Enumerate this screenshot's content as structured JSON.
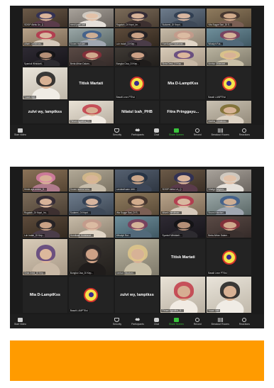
{
  "top": {
    "tiles": [
      {
        "kind": "cam",
        "name": "SDSIP Aleks Un_Q",
        "c": [
          "#6b5a48",
          "#3b2f26",
          "#d9b39a",
          "#2b2e58",
          "#5a3b4a"
        ]
      },
      {
        "kind": "cam",
        "name": "mesti jalan Arif",
        "c": [
          "#a9a39b",
          "#6b6560",
          "#e2c1a8",
          "#d9d2c9",
          "#e5e0da"
        ]
      },
      {
        "kind": "cam",
        "name": "Rugaiah_DI Kepri_Im...",
        "c": [
          "#7b6b59",
          "#4b3f33",
          "#d6b298",
          "#2c2433",
          "#3d3030"
        ]
      },
      {
        "kind": "cam",
        "name": "Sudarmi_DI Kepri...",
        "c": [
          "#6e7c8c",
          "#3c4653",
          "#d7b59f",
          "#2c3a4d",
          "#3e4958"
        ]
      },
      {
        "kind": "cam",
        "name": "Vita Sugye Sari_DI S...",
        "c": [
          "#8f7b5e",
          "#5a4b38",
          "#d1ab8c",
          "#3d2f2a",
          "#7b5f54"
        ]
      },
      {
        "kind": "cam",
        "name": "Alfarti Christinaw...",
        "c": [
          "#b8a38a",
          "#7d6a56",
          "#d8b8a0",
          "#b5314a",
          "#d6c9bb"
        ]
      },
      {
        "kind": "cam",
        "name": "Srunni Handari...",
        "c": [
          "#9aa7a7",
          "#5b6867",
          "#cdae95",
          "#3a5b8a",
          "#a0a7b1"
        ]
      },
      {
        "kind": "cam",
        "name": "Luh Indah_DI Kep...",
        "c": [
          "#5d4b3b",
          "#33291f",
          "#caa286",
          "#1e1d22",
          "#4a3c48"
        ]
      },
      {
        "kind": "cam",
        "name": "Hornikaeli Hutabarat...",
        "c": [
          "#c7bba8",
          "#8e8271",
          "#dbbba2",
          "#c59a8b",
          "#e1d5c6"
        ]
      },
      {
        "kind": "cam",
        "name": "Winaiyh Rut...",
        "c": [
          "#6f8f9b",
          "#405863",
          "#d5b399",
          "#7b3a59",
          "#52697a"
        ]
      },
      {
        "kind": "cam",
        "name": "Syaniuli Winidarti...",
        "c": [
          "#2e2a33",
          "#17151a",
          "#b48f77",
          "#121214",
          "#2d2b30"
        ]
      },
      {
        "kind": "cam",
        "name": "Berta Afrian Dalam...",
        "c": [
          "#5a4a45",
          "#352b29",
          "#d1a98d",
          "#8b2e3a",
          "#3a302e"
        ]
      },
      {
        "kind": "cam",
        "name": "Bungka Cisa_DI Kep...",
        "c": [
          "#3f3a35",
          "#221f1c",
          "#cda186",
          "#2a2626",
          "#1f1c1b"
        ]
      },
      {
        "kind": "cam",
        "name": "Sinta Dewi_DI Kep...",
        "c": [
          "#d8cbb8",
          "#a89987",
          "#dcb79c",
          "#5a3e7a",
          "#c9b9a6"
        ]
      },
      {
        "kind": "cam",
        "name": "Annisa Oktaviani...",
        "c": [
          "#b9b39f",
          "#7f7a6b",
          "#d7b296",
          "#e0c78a",
          "#c9c0a8"
        ]
      },
      {
        "kind": "cam",
        "name": "Yusari Aish",
        "c": [
          "#e9e4da",
          "#c0b8aa",
          "#d8b194",
          "#1c1c1c",
          "#f0ece5"
        ]
      },
      {
        "kind": "blank",
        "name": "Titisk Martati"
      },
      {
        "kind": "logo",
        "name": "Basalt Leon PTKsi"
      },
      {
        "kind": "blank",
        "name": "Mia D-LamptKss"
      },
      {
        "kind": "logo",
        "name": "Basalt LAMPTKsi"
      },
      {
        "kind": "blank",
        "name": "zulvi wy, lamptkss"
      },
      {
        "kind": "cam",
        "name": "Fitriani Agustina_D...",
        "c": [
          "#e9e2d6",
          "#b9b0a2",
          "#d6ae92",
          "#c23a46",
          "#f1ebe3"
        ]
      },
      {
        "kind": "blank",
        "name": "Nilatul Izah_PHB"
      },
      {
        "kind": "blank",
        "name": "Fitra Pringgayu..."
      },
      {
        "kind": "cam",
        "name": "Martha_Citrakusu...",
        "c": [
          "#c9c1b2",
          "#958c7c",
          "#d7b395",
          "#7a6a2a",
          "#ddd3c4"
        ]
      }
    ],
    "toolbar": [
      "Start Video",
      "Security",
      "Participants",
      "Chat",
      "Share Screen",
      "Record",
      "Breakout Rooms",
      "Reactions"
    ]
  },
  "bottom": {
    "tiles": [
      {
        "kind": "cam",
        "name": "Hesfa aya ambrs_D...",
        "c": [
          "#8a7258",
          "#564533",
          "#d7b097",
          "#d97fa7",
          "#b07b8c"
        ]
      },
      {
        "kind": "cam",
        "name": "Srunni Isetrhe tuba...",
        "c": [
          "#b2a997",
          "#7b7363",
          "#d8b598",
          "#d6ba8a",
          "#c6bcaa"
        ]
      },
      {
        "kind": "cam",
        "name": "Landasthuam Jefri...",
        "c": [
          "#556070",
          "#2f3742",
          "#caa589",
          "#233042",
          "#3c4657"
        ]
      },
      {
        "kind": "cam",
        "name": "SDSIP Aleks Un_Q",
        "c": [
          "#6b5a48",
          "#3b2f26",
          "#d9b39a",
          "#2b2e58",
          "#5a3b4a"
        ]
      },
      {
        "kind": "cam",
        "name": "Vitaligt Fatiyurs...",
        "c": [
          "#a9a39b",
          "#6b6560",
          "#e2c1a8",
          "#d9d2c9",
          "#e5e0da"
        ]
      },
      {
        "kind": "cam",
        "name": "Rugaiah_DI Kepri_Im...",
        "c": [
          "#7b6b59",
          "#4b3f33",
          "#d6b298",
          "#2c2433",
          "#3d3030"
        ]
      },
      {
        "kind": "cam",
        "name": "Sudarmi_DI Kepri...",
        "c": [
          "#6e7c8c",
          "#3c4653",
          "#d7b59f",
          "#2c3a4d",
          "#3e4958"
        ]
      },
      {
        "kind": "cam",
        "name": "Vita Sugye Sari_DI S...",
        "c": [
          "#8f7b5e",
          "#5a4b38",
          "#d1ab8c",
          "#3d2f2a",
          "#7b5f54"
        ]
      },
      {
        "kind": "cam",
        "name": "Alfarti Christinaw...",
        "c": [
          "#b8a38a",
          "#7d6a56",
          "#d8b8a0",
          "#b5314a",
          "#d6c9bb"
        ]
      },
      {
        "kind": "cam",
        "name": "Srunni Handari...",
        "c": [
          "#9aa7a7",
          "#5b6867",
          "#cdae95",
          "#3a5b8a",
          "#a0a7b1"
        ]
      },
      {
        "kind": "cam",
        "name": "Luh Indah_DI Kep...",
        "c": [
          "#5d4b3b",
          "#33291f",
          "#caa286",
          "#1e1d22",
          "#4a3c48"
        ]
      },
      {
        "kind": "cam",
        "name": "Hornikaeli Hutabarat...",
        "c": [
          "#c7bba8",
          "#8e8271",
          "#dbbba2",
          "#c59a8b",
          "#e1d5c6"
        ]
      },
      {
        "kind": "cam",
        "name": "Winaiyh Rut...",
        "c": [
          "#6f8f9b",
          "#405863",
          "#d5b399",
          "#7b3a59",
          "#52697a"
        ]
      },
      {
        "kind": "cam",
        "name": "Syaniuli Winidarti...",
        "c": [
          "#2e2a33",
          "#17151a",
          "#b48f77",
          "#121214",
          "#2d2b30"
        ]
      },
      {
        "kind": "cam",
        "name": "Berta Afrian Dalam...",
        "c": [
          "#5a4a45",
          "#352b29",
          "#d1a98d",
          "#8b2e3a",
          "#3a302e"
        ]
      },
      {
        "kind": "cam",
        "name": "Sinta Dewi_DI Kep...",
        "c": [
          "#d8cbb8",
          "#a89987",
          "#dcb79c",
          "#5a3e7a",
          "#c9b9a6"
        ]
      },
      {
        "kind": "cam",
        "name": "Bungka Cisa_DI Kep...",
        "c": [
          "#3f3a35",
          "#221f1c",
          "#cda186",
          "#2a2626",
          "#1f1c1b"
        ]
      },
      {
        "kind": "cam",
        "name": "Annisa Oktaviani...",
        "c": [
          "#b9b39f",
          "#7f7a6b",
          "#d7b296",
          "#e0c78a",
          "#c9c0a8"
        ]
      },
      {
        "kind": "blank",
        "name": "Titisk Martati"
      },
      {
        "kind": "logo",
        "name": "Basalt Leon PTKsi"
      },
      {
        "kind": "blank",
        "name": "Mia D-LamptKss"
      },
      {
        "kind": "logo",
        "name": "Basalt LAMPTKsi"
      },
      {
        "kind": "blank",
        "name": "zulvi wy, lamptkss"
      },
      {
        "kind": "cam",
        "name": "Fitriani Agustina_D...",
        "c": [
          "#e9e2d6",
          "#b9b0a2",
          "#d6ae92",
          "#c23a46",
          "#f1ebe3"
        ]
      },
      {
        "kind": "cam",
        "name": "Yusari Aish",
        "c": [
          "#e9e4da",
          "#c0b8aa",
          "#d8b194",
          "#1c1c1c",
          "#f0ece5"
        ]
      }
    ],
    "toolbar": [
      "Start Video",
      "Security",
      "Participants",
      "Chat",
      "Share Screen",
      "Record",
      "Breakout Rooms",
      "Reactions"
    ]
  },
  "banner": {
    "color": "#ff9b00"
  }
}
